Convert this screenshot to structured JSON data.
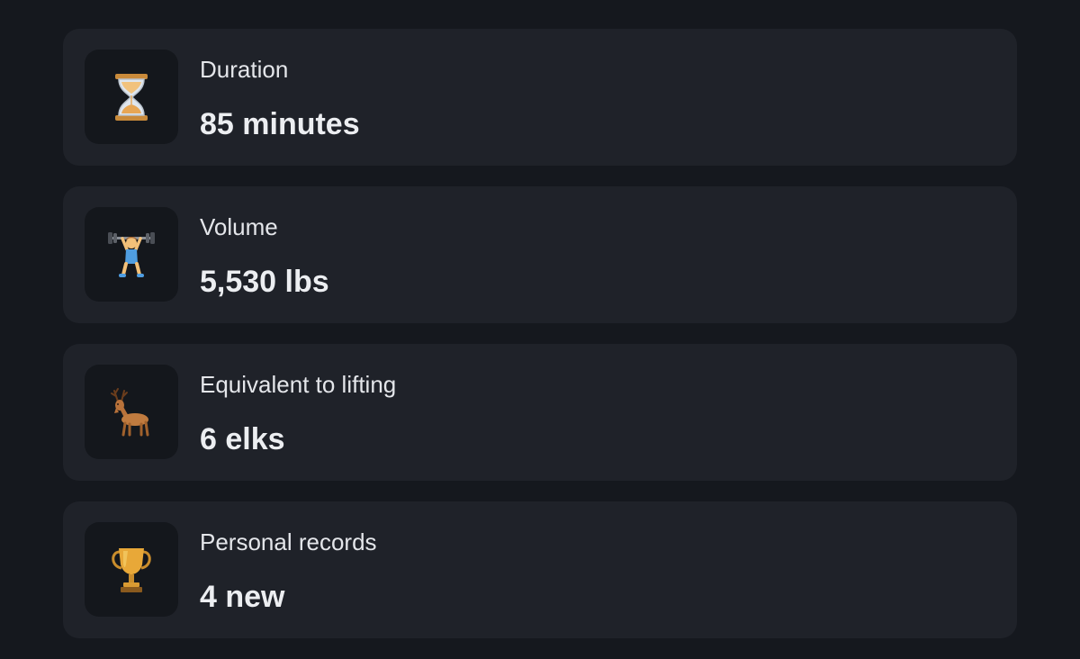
{
  "stats": [
    {
      "icon": "hourglass-icon",
      "label": "Duration",
      "value": "85 minutes"
    },
    {
      "icon": "weightlifter-icon",
      "label": "Volume",
      "value": "5,530 lbs"
    },
    {
      "icon": "deer-icon",
      "label": "Equivalent to lifting",
      "value": "6 elks"
    },
    {
      "icon": "trophy-icon",
      "label": "Personal records",
      "value": "4 new"
    }
  ],
  "colors": {
    "background": "#15181e",
    "card": "#1f2229",
    "icon_tile": "#14171c",
    "text": "#e4e6ea"
  }
}
